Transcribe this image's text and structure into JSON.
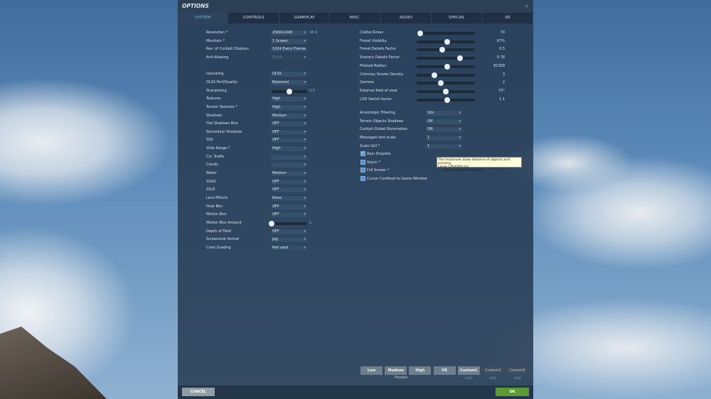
{
  "window": {
    "title": "OPTIONS",
    "close": "×"
  },
  "tabs": [
    "SYSTEM",
    "CONTROLS",
    "GAMEPLAY",
    "MISC.",
    "AUDIO",
    "SPECIAL",
    "VR"
  ],
  "left_settings": [
    {
      "label": "Resolution *",
      "value": "2560x1440",
      "extra": "16:9"
    },
    {
      "label": "Monitors *",
      "value": "1 Screen"
    },
    {
      "label": "Res. of Cockpit Displays",
      "value": "1024 Every Frame"
    },
    {
      "label": "Anti-Aliasing",
      "value": "DLAA",
      "disabled": true
    },
    null,
    {
      "label": "Upscaling",
      "value": "DLSS"
    },
    {
      "label": "DLSS Perf/Quality",
      "value": "Balanced"
    },
    {
      "label": "Sharpening",
      "slider": 0.5,
      "display": "0.5"
    },
    {
      "label": "Textures",
      "value": "High"
    },
    {
      "label": "Terrain Textures *",
      "value": "High"
    },
    {
      "label": "Shadows",
      "value": "Medium"
    },
    {
      "label": "Flat Shadows Blur",
      "value": "OFF"
    },
    {
      "label": "Secondary Shadows",
      "value": "OFF"
    },
    {
      "label": "SSS",
      "value": "OFF"
    },
    {
      "label": "Visib Range *",
      "value": "High"
    },
    {
      "label": "Civ. Traffic",
      "value": ""
    },
    {
      "label": "Clouds",
      "value": ""
    },
    {
      "label": "Water",
      "value": "Medium"
    },
    {
      "label": "SSAO",
      "value": "OFF"
    },
    {
      "label": "SSLR",
      "value": "OFF"
    },
    {
      "label": "Lens Effects",
      "value": "None"
    },
    {
      "label": "Heat Blur",
      "value": "OFF"
    },
    {
      "label": "Motion Blur",
      "value": "OFF"
    },
    {
      "label": "Motion Blur Amount",
      "slider": 0.0,
      "display": "1"
    },
    {
      "label": "Depth of Field",
      "value": "OFF"
    },
    {
      "label": "Screenshot format",
      "value": "jpg"
    },
    {
      "label": "Color Grading",
      "value": "Not used"
    }
  ],
  "right_sliders": [
    {
      "label": "Clutter/Grass",
      "fraction": 0.06,
      "display": "70"
    },
    {
      "label": "Forest Visibility",
      "fraction": 0.52,
      "display": "67%"
    },
    {
      "label": "Forest Details Factor",
      "fraction": 0.44,
      "display": "0.5"
    },
    {
      "label": "Scenery Details Factor",
      "fraction": 0.74,
      "display": "0.78"
    },
    {
      "label": "Preload Radius",
      "fraction": 0.53,
      "display": "81300"
    },
    {
      "label": "Chimney Smoke Density",
      "fraction": 0.31,
      "display": "3"
    },
    {
      "label": "Gamma",
      "fraction": 0.41,
      "display": "2"
    },
    {
      "label": "External field of view",
      "fraction": 0.5,
      "display": "73°"
    },
    {
      "label": "LOD Switch factor",
      "fraction": 0.53,
      "display": "1.1"
    }
  ],
  "right_dropdowns": [
    {
      "label": "Anisotropic Filtering",
      "value": "16x"
    },
    {
      "label": "Terrain Objects Shadows",
      "value": "Off"
    },
    {
      "label": "Cockpit Global Illumination",
      "value": "ON"
    },
    {
      "label": "Messages font scale",
      "value": "1"
    },
    {
      "label": "Scale GUI *",
      "value": "1"
    }
  ],
  "checkboxes": [
    {
      "label": "Rain Droplets",
      "checked": true
    },
    {
      "label": "Vsync *",
      "checked": false
    },
    {
      "label": "Full Screen *",
      "checked": false
    },
    {
      "label": "Cursor Confined to Game Window",
      "checked": false
    }
  ],
  "tooltip": {
    "line1": "The maximum draw distance of objects and scenery.",
    "line2": "Large CPU/GPU hit.",
    "line3": "* - Game restart is required."
  },
  "presets": {
    "label": "Presets",
    "buttons": [
      "Low",
      "Medium",
      "High",
      "VR",
      "Custom1",
      "Custom2",
      "Custom3"
    ],
    "save": "SAVE"
  },
  "footer": {
    "cancel": "CANCEL",
    "ok": "OK"
  }
}
